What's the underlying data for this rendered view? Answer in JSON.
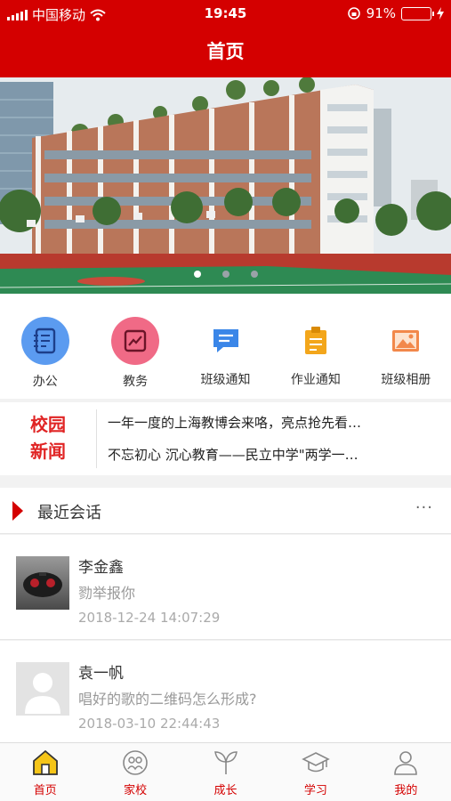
{
  "status": {
    "carrier": "中国移动",
    "time": "19:45",
    "battery": "91%"
  },
  "nav": {
    "title": "首页"
  },
  "banner": {
    "slides": 3,
    "active": 0
  },
  "quick": [
    {
      "label": "办公",
      "icon": "notebook-icon",
      "color": "#5b9bf0"
    },
    {
      "label": "教务",
      "icon": "chart-card-icon",
      "color": "#f06a86"
    },
    {
      "label": "班级通知",
      "icon": "message-icon",
      "color": "#3a86e8"
    },
    {
      "label": "作业通知",
      "icon": "clipboard-icon",
      "color": "#f3a61b"
    },
    {
      "label": "班级相册",
      "icon": "photo-icon",
      "color": "#f2884a"
    }
  ],
  "news": {
    "tag_line1": "校园",
    "tag_line2": "新闻",
    "items": [
      "一年一度的上海教博会来咯，亮点抢先看…",
      "不忘初心 沉心教育——民立中学\"两学一…"
    ]
  },
  "conversations": {
    "title": "最近会话",
    "more": "···",
    "items": [
      {
        "name": "李金鑫",
        "message": "勠举报你",
        "time": "2018-12-24 14:07:29"
      },
      {
        "name": "袁一帆",
        "message": "唱好的歌的二维码怎么形成?",
        "time": "2018-03-10 22:44:43"
      }
    ]
  },
  "tabs": [
    {
      "label": "首页",
      "icon": "home-icon",
      "active": true
    },
    {
      "label": "家校",
      "icon": "family-icon"
    },
    {
      "label": "成长",
      "icon": "sprout-icon"
    },
    {
      "label": "学习",
      "icon": "graduation-cap-icon"
    },
    {
      "label": "我的",
      "icon": "person-icon"
    }
  ],
  "colors": {
    "brand": "#d40000",
    "news_tag": "#e02424"
  }
}
